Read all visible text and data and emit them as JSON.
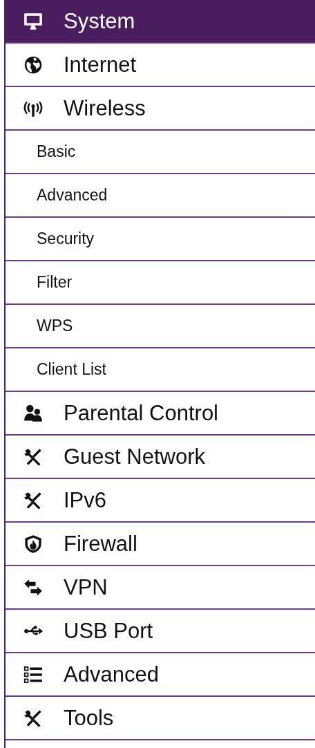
{
  "menu": [
    {
      "label": "System",
      "kind": "main",
      "selected": true
    },
    {
      "label": "Internet",
      "kind": "main",
      "selected": false
    },
    {
      "label": "Wireless",
      "kind": "main",
      "selected": false
    },
    {
      "label": "Basic",
      "kind": "sub",
      "selected": false
    },
    {
      "label": "Advanced",
      "kind": "sub",
      "selected": false
    },
    {
      "label": "Security",
      "kind": "sub",
      "selected": false
    },
    {
      "label": "Filter",
      "kind": "sub",
      "selected": false
    },
    {
      "label": "WPS",
      "kind": "sub",
      "selected": false
    },
    {
      "label": "Client List",
      "kind": "sub",
      "selected": false
    },
    {
      "label": "Parental Control",
      "kind": "main",
      "selected": false
    },
    {
      "label": "Guest Network",
      "kind": "main",
      "selected": false
    },
    {
      "label": "IPv6",
      "kind": "main",
      "selected": false
    },
    {
      "label": "Firewall",
      "kind": "main",
      "selected": false
    },
    {
      "label": "VPN",
      "kind": "main",
      "selected": false
    },
    {
      "label": "USB Port",
      "kind": "main",
      "selected": false
    },
    {
      "label": "Advanced",
      "kind": "main",
      "selected": false
    },
    {
      "label": "Tools",
      "kind": "main",
      "selected": false
    }
  ]
}
